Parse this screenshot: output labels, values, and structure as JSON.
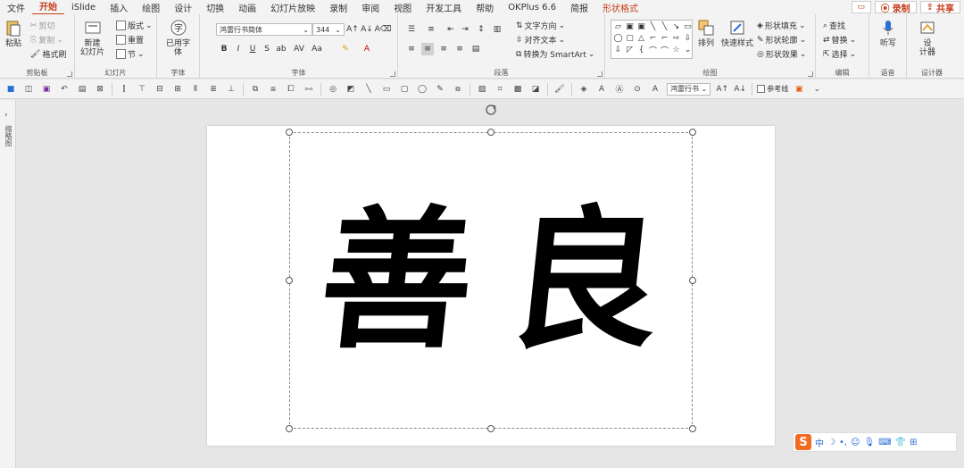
{
  "menu": {
    "items": [
      "文件",
      "开始",
      "iSlide",
      "插入",
      "绘图",
      "设计",
      "切换",
      "动画",
      "幻灯片放映",
      "录制",
      "审阅",
      "视图",
      "开发工具",
      "帮助",
      "OKPlus 6.6",
      "简报",
      "形状格式"
    ],
    "active": "开始",
    "record_label": "录制",
    "share_label": "共享"
  },
  "ribbon": {
    "clipboard": {
      "paste": "粘贴",
      "cut": "剪切",
      "copy": "复制",
      "format_painter": "格式刷",
      "label": "剪贴板"
    },
    "slides": {
      "new_slide": "新建",
      "new_slide2": "幻灯片",
      "layout": "版式",
      "reset": "重置",
      "section": "节",
      "label": "幻灯片"
    },
    "font_use": {
      "label1": "已用字",
      "label2": "体",
      "label": "字体"
    },
    "font": {
      "name": "鸿雷行书简体",
      "size": "344",
      "label": "字体"
    },
    "paragraph": {
      "text_direction": "文字方向",
      "align_text": "对齐文本",
      "smartart": "转换为 SmartArt",
      "label": "段落"
    },
    "drawing": {
      "arrange": "排列",
      "quick_styles": "快速样式",
      "fill": "形状填充",
      "outline": "形状轮廓",
      "effects": "形状效果",
      "label": "绘图"
    },
    "editing": {
      "find": "查找",
      "replace": "替换",
      "select": "选择",
      "label": "编辑"
    },
    "voice": {
      "dictate": "听写",
      "label": "语音"
    },
    "designer": {
      "design": "设",
      "design2": "计器",
      "label": "设计器"
    }
  },
  "qat": {
    "font": "鸿雷行书",
    "guides": "参考线"
  },
  "leftpane": {
    "label": "缩略图"
  },
  "slide": {
    "text": [
      "善",
      "良"
    ]
  },
  "ime": {
    "mode": "中"
  }
}
